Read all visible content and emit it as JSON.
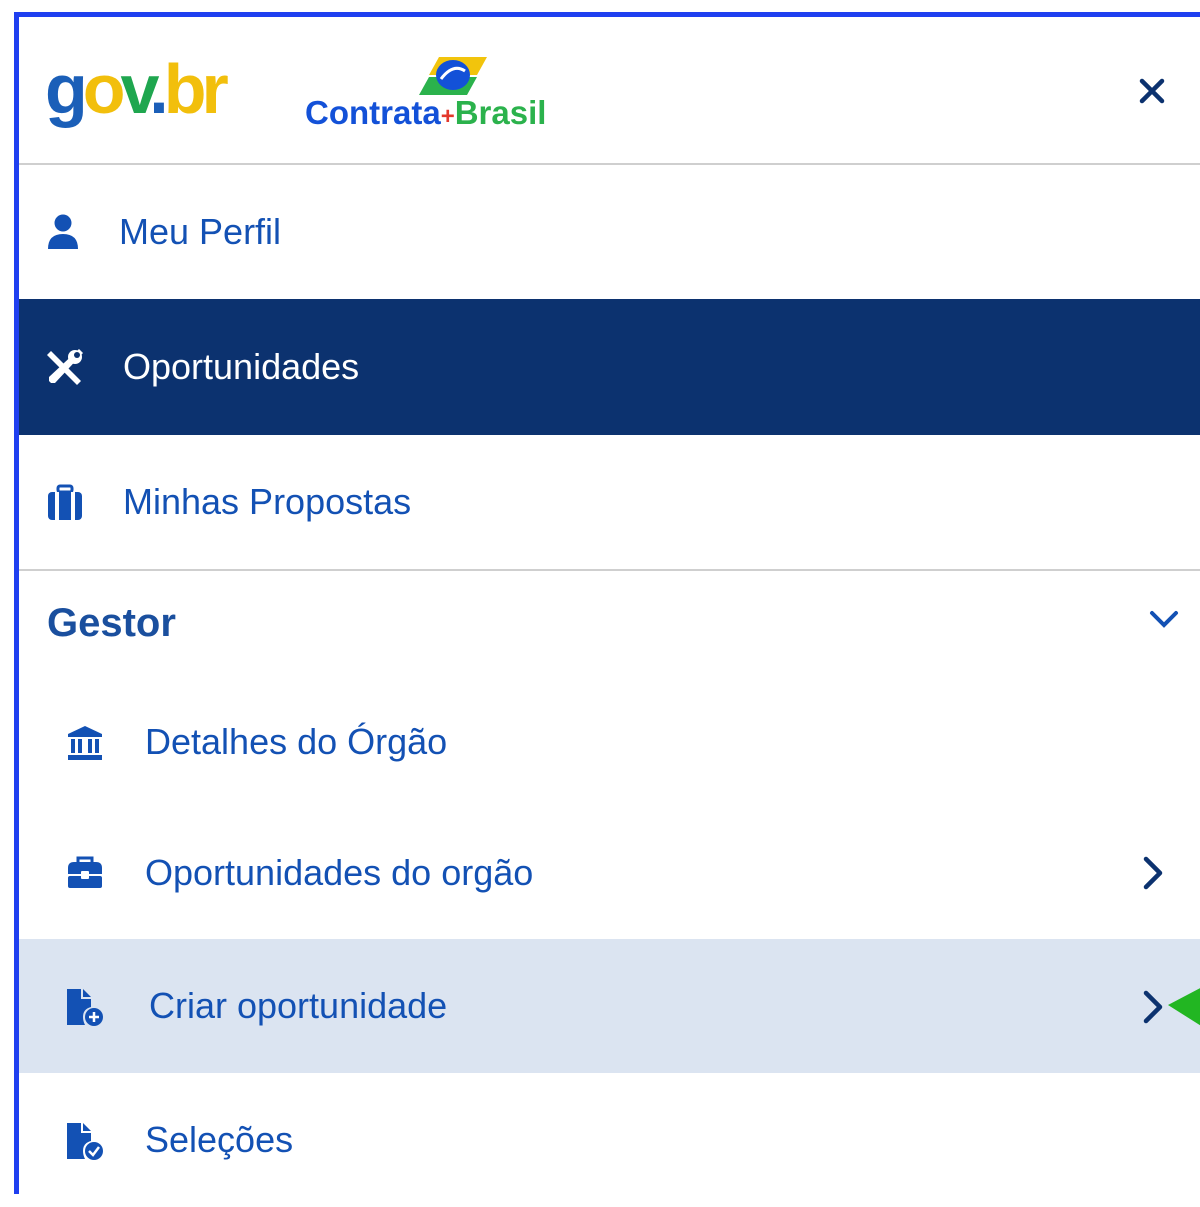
{
  "header": {
    "gov_logo": "gov.br",
    "contrata_logo": {
      "word1": "Contrata",
      "plus": "+",
      "word2": "Brasil"
    },
    "close_icon": "close-icon"
  },
  "menu": {
    "items": [
      {
        "label": "Meu Perfil",
        "icon": "user-icon"
      },
      {
        "label": "Oportunidades",
        "icon": "tools-icon",
        "active": true
      },
      {
        "label": "Minhas Propostas",
        "icon": "briefcase-icon"
      }
    ]
  },
  "gestor": {
    "title": "Gestor",
    "items": [
      {
        "label": "Detalhes do Órgão",
        "icon": "institution-icon"
      },
      {
        "label": "Oportunidades do orgão",
        "icon": "toolbox-icon"
      },
      {
        "label": "Criar oportunidade",
        "icon": "file-add-icon",
        "highlighted": true
      },
      {
        "label": "Seleções",
        "icon": "file-check-icon"
      }
    ]
  },
  "colors": {
    "frame": "#1f3ff0",
    "primary": "#1351b4",
    "active_bg": "#0c326f",
    "highlight_bg": "#dbe4f1",
    "cursor": "#22b622"
  }
}
